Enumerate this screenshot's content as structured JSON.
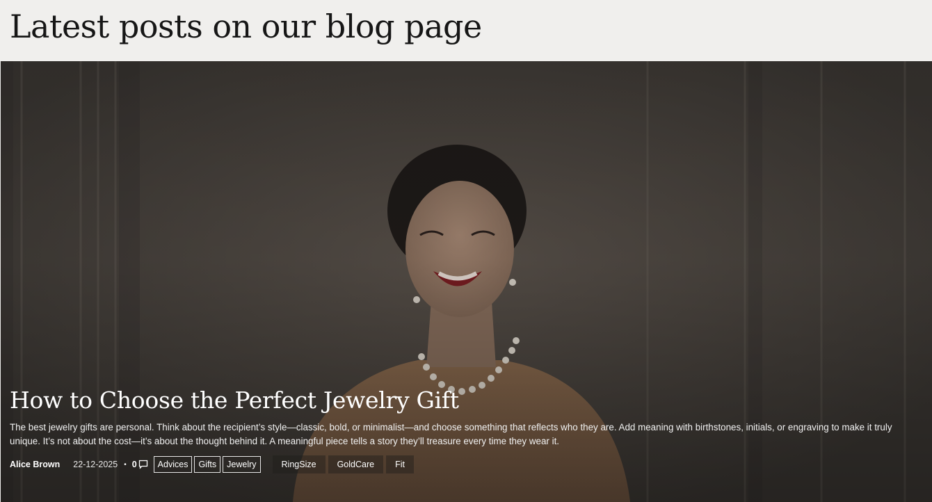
{
  "header": {
    "title": "Latest posts on our blog page"
  },
  "post": {
    "title": "How to Choose the Perfect Jewelry Gift",
    "excerpt": "The best jewelry gifts are personal. Think about the recipient’s style—classic, bold, or minimalist—and choose something that reflects who they are. Add meaning with birthstones, initials, or engraving to make it truly unique. It’s not about the cost—it’s about the thought behind it. A meaningful piece tells a story they’ll treasure every time they wear it.",
    "author": "Alice Brown",
    "date": "22-12-2025",
    "separator": "•",
    "comments": "0",
    "categories": [
      "Advices",
      "Gifts",
      "Jewelry"
    ],
    "tags": [
      "RingSize",
      "GoldCare",
      "Fit"
    ]
  },
  "icons": {
    "comments": "comment-icon"
  },
  "colors": {
    "header_bg": "#f0efed",
    "title_text": "#161616",
    "overlay_text": "#ffffff"
  }
}
